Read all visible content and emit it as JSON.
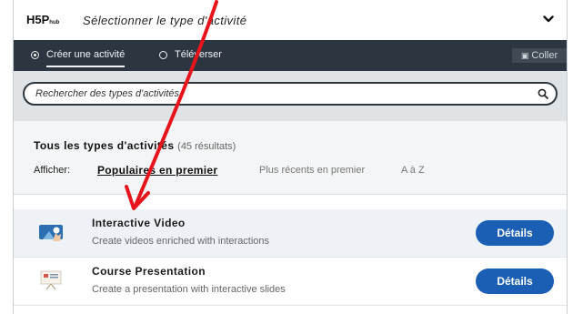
{
  "header": {
    "logo_text": "H5P",
    "logo_sub": "hub",
    "title": "Sélectionner le type d'activité",
    "chevron_icon": "chevron-down-icon"
  },
  "tabs": [
    {
      "label": "Créer une activité",
      "selected": true
    },
    {
      "label": "Téléverser",
      "selected": false
    }
  ],
  "paste": {
    "label": "Coller",
    "icon": "clipboard-icon"
  },
  "search": {
    "placeholder": "Rechercher des types d'activités",
    "value": "",
    "icon": "search-icon"
  },
  "results": {
    "title": "Tous les types d'activités",
    "count": "(45 résultats)"
  },
  "sort": {
    "label": "Afficher:",
    "options": [
      "Populaires en premier",
      "Plus récents en premier",
      "A à Z"
    ],
    "selected": "Populaires en premier"
  },
  "content_types": [
    {
      "name": "Interactive Video",
      "description": "Create videos enriched with interactions",
      "button": "Détails",
      "icon": "interactive-video-icon"
    },
    {
      "name": "Course Presentation",
      "description": "Create a presentation with interactive slides",
      "button": "Détails",
      "icon": "course-presentation-icon"
    }
  ],
  "colors": {
    "tab_bar": "#2d3640",
    "search_area": "#dfe3e6",
    "details_button": "#1a5fb4",
    "annotation_arrow": "#e8141c"
  }
}
